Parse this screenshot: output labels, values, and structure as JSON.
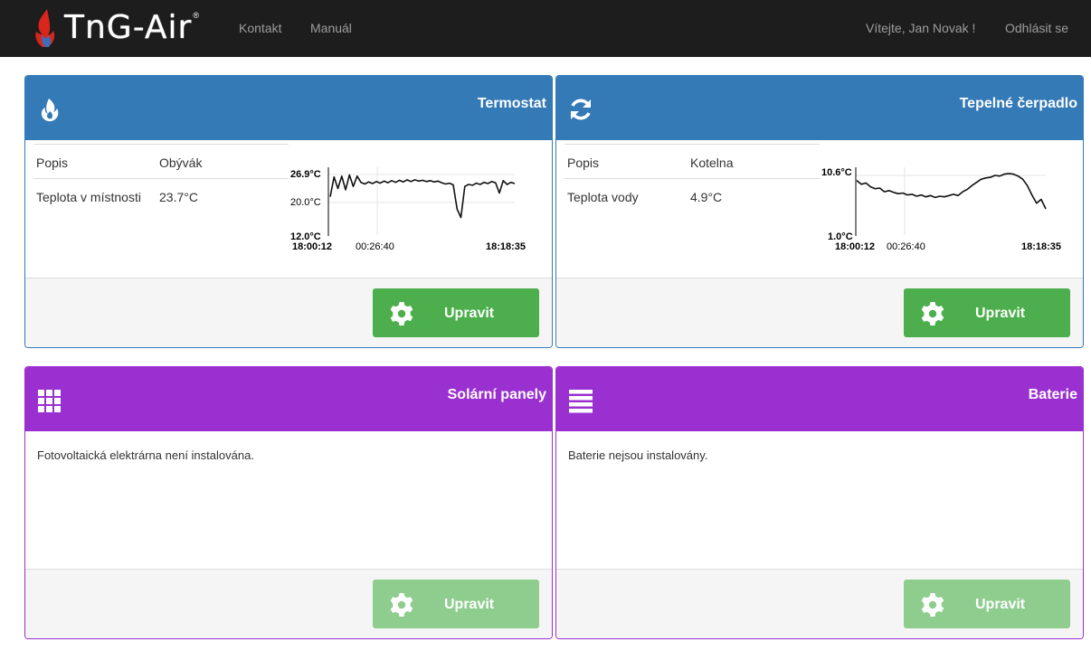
{
  "nav": {
    "brand": "TnG-Air",
    "brand_mark": "®",
    "links": [
      "Kontakt",
      "Manuál"
    ],
    "welcome": "Vítejte, Jan Novak !",
    "logout": "Odhlásit se"
  },
  "colors": {
    "navbar": "#1d1d1d",
    "blue": "#337ab7",
    "purple": "#9b30d0",
    "green": "#4cae4c",
    "green_disabled": "#8fcd8f"
  },
  "panels": {
    "thermostat": {
      "title": "Termostat",
      "icon": "flame-icon",
      "rows": [
        {
          "key": "Popis",
          "value": "Obývák"
        },
        {
          "key": "Teplota v místnosti",
          "value": "23.7°C"
        }
      ],
      "button": "Upravit"
    },
    "heatpump": {
      "title": "Tepelné čerpadlo",
      "icon": "refresh-icon",
      "rows": [
        {
          "key": "Popis",
          "value": "Kotelna"
        },
        {
          "key": "Teplota vody",
          "value": "4.9°C"
        }
      ],
      "button": "Upravit"
    },
    "solar": {
      "title": "Solární panely",
      "icon": "grid-icon",
      "message": "Fotovoltaická elektrárna není instalována.",
      "button": "Upravit"
    },
    "battery": {
      "title": "Baterie",
      "icon": "stack-icon",
      "message": "Baterie nejsou instalovány.",
      "button": "Upravit"
    }
  },
  "chart_data": [
    {
      "type": "line",
      "panel": "Termostat",
      "y_ticks": [
        "26.9°C",
        "20.0°C",
        "12.0°C"
      ],
      "x_ticks": [
        "18:00:12",
        "00:26:40",
        "18:18:35"
      ],
      "ylim": [
        12.0,
        26.9
      ],
      "series": [
        {
          "values": [
            21.5,
            26.3,
            23.5,
            26.5,
            23.2,
            26.8,
            24.0,
            26.5,
            25.0,
            24.6,
            25.1,
            24.7,
            25.2,
            24.8,
            25.3,
            24.9,
            25.4,
            25.0,
            25.5,
            25.1,
            25.6,
            25.2,
            25.6,
            25.3,
            25.5,
            25.2,
            25.4,
            25.1,
            25.3,
            24.9,
            24.6,
            24.8,
            24.4,
            18.5,
            16.5,
            24.0,
            24.5,
            24.3,
            24.8,
            24.5,
            25.0,
            24.7,
            25.2,
            24.9,
            22.4,
            25.4,
            24.5,
            25.0,
            24.7
          ]
        }
      ]
    },
    {
      "type": "line",
      "panel": "Tepelné čerpadlo",
      "y_ticks": [
        "10.6°C",
        "1.0°C"
      ],
      "x_ticks": [
        "18:00:12",
        "00:26:40",
        "18:18:35"
      ],
      "ylim": [
        1.0,
        10.6
      ],
      "series": [
        {
          "values": [
            9.8,
            9.2,
            9.4,
            8.8,
            8.5,
            8.6,
            8.0,
            8.2,
            7.9,
            7.7,
            7.8,
            7.5,
            7.6,
            7.3,
            7.5,
            7.2,
            7.4,
            7.1,
            7.3,
            7.2,
            7.4,
            7.6,
            7.4,
            8.0,
            8.4,
            9.0,
            9.5,
            10.0,
            10.2,
            10.3,
            10.6,
            10.5,
            10.8,
            10.9,
            10.8,
            10.5,
            10.0,
            9.0,
            7.5,
            6.2,
            6.8,
            5.3
          ]
        }
      ]
    }
  ]
}
